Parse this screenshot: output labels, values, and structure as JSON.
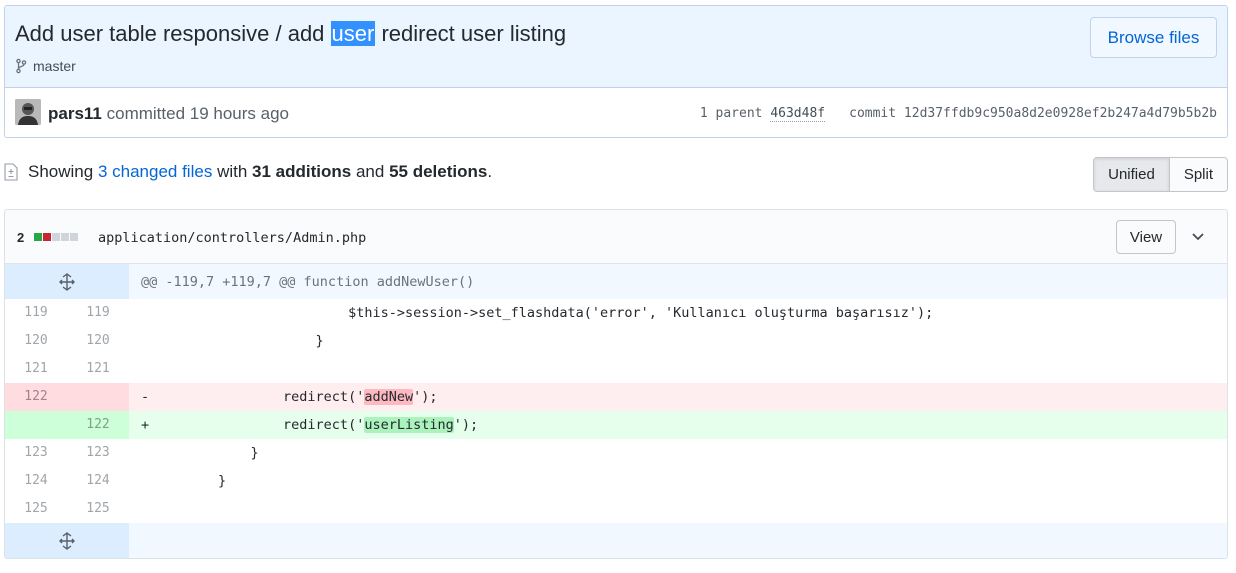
{
  "commit": {
    "title_before": "Add user table responsive / add ",
    "title_highlight": "user",
    "title_after": " redirect user listing",
    "branch": "master",
    "browse_label": "Browse files",
    "author": "pars11",
    "committed_text": " committed 19 hours ago",
    "parent_label": "1 parent",
    "parent_sha": "463d48f",
    "commit_label": "commit",
    "commit_sha": "12d37ffdb9c950a8d2e0928ef2b247a4d79b5b2b"
  },
  "toc": {
    "showing": "Showing",
    "changed_files": "3 changed files",
    "with": "with",
    "additions": "31 additions",
    "and": "and",
    "deletions": "55 deletions",
    "period": "."
  },
  "view_toggle": {
    "unified": "Unified",
    "split": "Split",
    "selected": "Unified"
  },
  "file": {
    "changes": "2",
    "diffstat": [
      "added",
      "deleted",
      "neutral",
      "neutral",
      "neutral"
    ],
    "path": "application/controllers/Admin.php",
    "view_label": "View",
    "hunk_header": "@@ -119,7 +119,7 @@ function addNewUser()",
    "lines": [
      {
        "old": "119",
        "new": "119",
        "type": "context",
        "marker": "",
        "code_indent": "                        ",
        "code": "$this->session->set_flashdata('error', 'Kullanıcı oluşturma başarısız');"
      },
      {
        "old": "120",
        "new": "120",
        "type": "context",
        "marker": "",
        "code": "                    }"
      },
      {
        "old": "121",
        "new": "121",
        "type": "context",
        "marker": "",
        "code": ""
      },
      {
        "old": "122",
        "new": "",
        "type": "del",
        "marker": "-",
        "pre": "                redirect('",
        "changed": "addNew",
        "post": "');"
      },
      {
        "old": "",
        "new": "122",
        "type": "add",
        "marker": "+",
        "pre": "                redirect('",
        "changed": "userListing",
        "post": "');"
      },
      {
        "old": "123",
        "new": "123",
        "type": "context",
        "marker": "",
        "code": "            }"
      },
      {
        "old": "124",
        "new": "124",
        "type": "context",
        "marker": "",
        "code": "        }"
      },
      {
        "old": "125",
        "new": "125",
        "type": "context",
        "marker": "",
        "code": ""
      }
    ]
  },
  "colors": {
    "accent": "#0366d6",
    "diff_added": "#28a745",
    "diff_deleted": "#cb2431",
    "diff_neutral": "#d1d5da"
  }
}
